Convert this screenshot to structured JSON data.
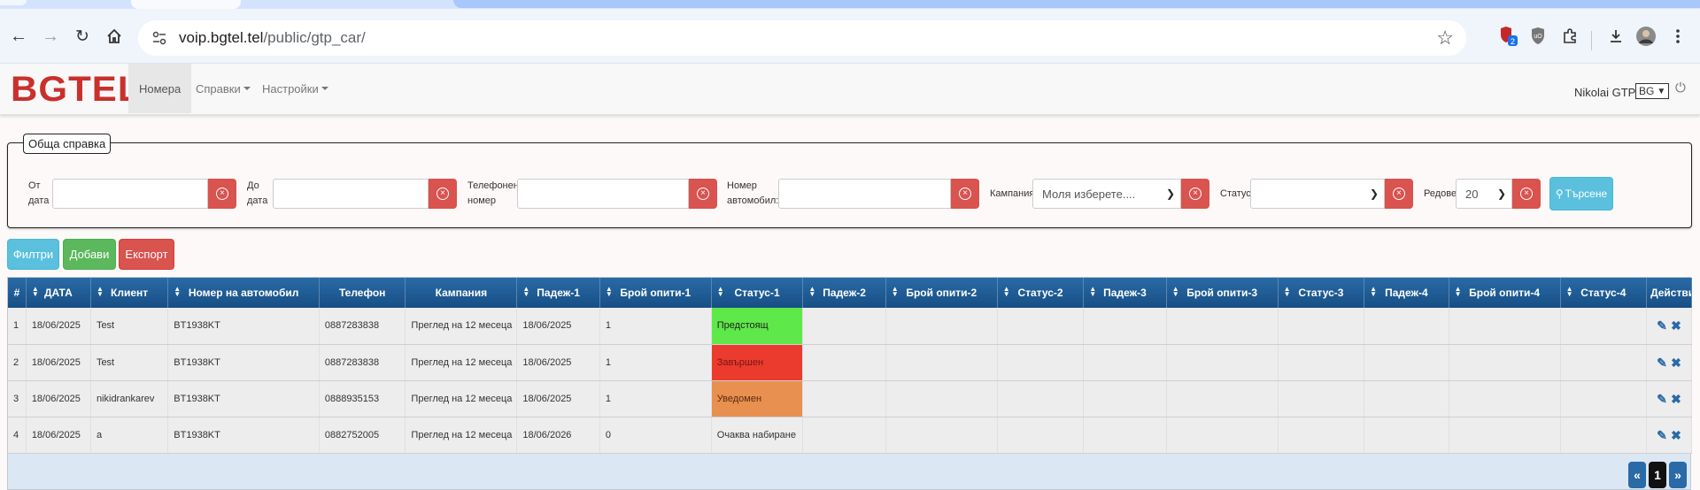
{
  "browser": {
    "url_host": "voip.bgtel.tel",
    "url_path": "/public/gtp_car/",
    "extension_badge": "2"
  },
  "app": {
    "logo": "BGTEL",
    "nav": {
      "numbers": "Номера",
      "reports": "Справки",
      "settings": "Настройки"
    },
    "user": "Nikolai GTP",
    "language": "BG"
  },
  "filters": {
    "legend": "Обща справка",
    "from_label_1": "От",
    "from_label_2": "дата",
    "to_label_1": "До",
    "to_label_2": "дата",
    "phone_label_1": "Телефонен",
    "phone_label_2": "номер",
    "car_label_1": "Номер",
    "car_label_2": "автомобил:",
    "campaign_label": "Кампания",
    "campaign_value": "Моля изберете....",
    "status_label": "Статус",
    "status_value": "",
    "rows_label": "Редове",
    "rows_value": "20",
    "search_button": "Търсене"
  },
  "actions": {
    "filter": "Филтри",
    "add": "Добави",
    "export": "Експорт"
  },
  "table": {
    "headers": [
      "#",
      "ДАТА",
      "Клиент",
      "Номер на автомобил",
      "Телефон",
      "Кампания",
      "Падеж-1",
      "Брой опити-1",
      "Статус-1",
      "Падеж-2",
      "Брой опити-2",
      "Статус-2",
      "Падеж-3",
      "Брой опити-3",
      "Статус-3",
      "Падеж-4",
      "Брой опити-4",
      "Статус-4",
      "Действия"
    ],
    "rows": [
      {
        "n": "1",
        "date": "18/06/2025",
        "client": "Test",
        "car": "BT1938KT",
        "phone": "0887283838",
        "campaign": "Преглед на 12 месеца",
        "due1": "18/06/2025",
        "tries1": "1",
        "status1": "Предстоящ",
        "status1_color": "#5fe84a"
      },
      {
        "n": "2",
        "date": "18/06/2025",
        "client": "Test",
        "car": "BT1938KT",
        "phone": "0887283838",
        "campaign": "Преглед на 12 месеца",
        "due1": "18/06/2025",
        "tries1": "1",
        "status1": "Завършен",
        "status1_color": "#ea3b2e"
      },
      {
        "n": "3",
        "date": "18/06/2025",
        "client": "nikidrankarev",
        "car": "BT1938KT",
        "phone": "0888935153",
        "campaign": "Преглед на 12 месеца",
        "due1": "18/06/2025",
        "tries1": "1",
        "status1": "Уведомен",
        "status1_color": "#e8904f"
      },
      {
        "n": "4",
        "date": "18/06/2025",
        "client": "a",
        "car": "BT1938KT",
        "phone": "0882752005",
        "campaign": "Преглед на 12 месеца",
        "due1": "18/06/2026",
        "tries1": "0",
        "status1": "Очаква набиране",
        "status1_color": ""
      }
    ]
  },
  "pagination": {
    "prev": "«",
    "current": "1",
    "next": "»"
  }
}
